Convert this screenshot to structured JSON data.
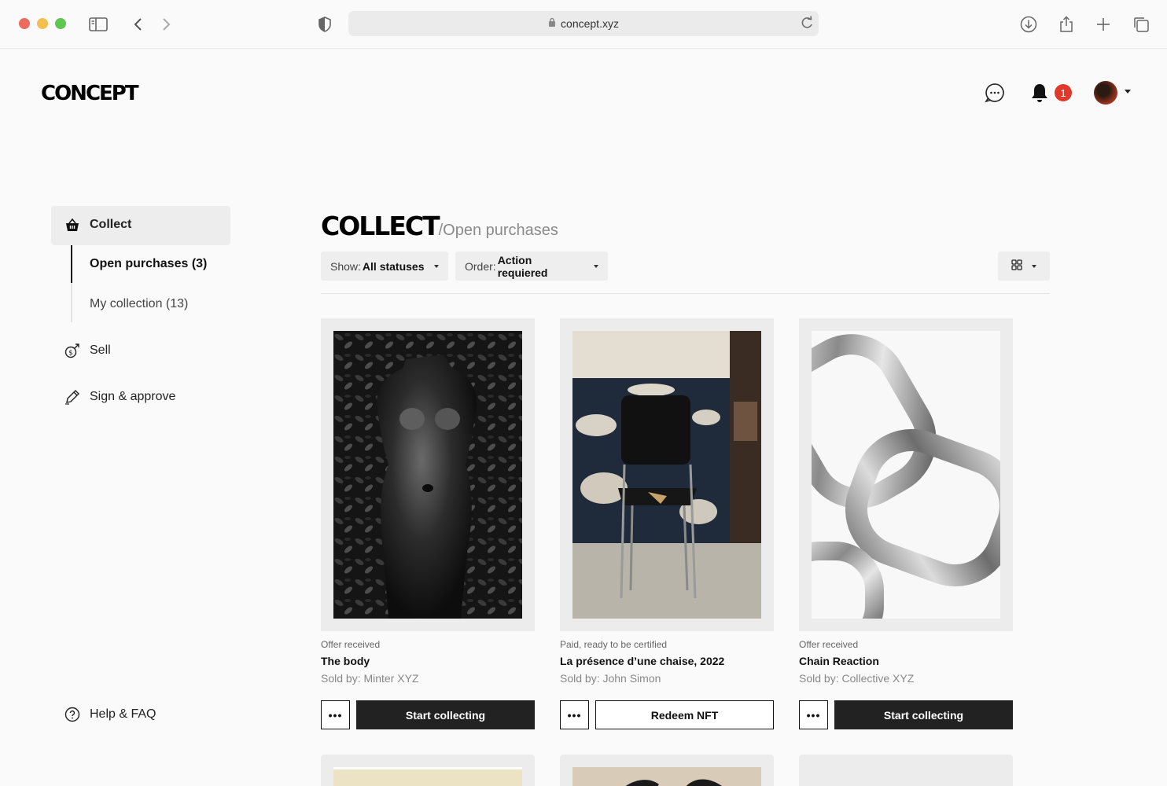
{
  "browser": {
    "url": "concept.xyz"
  },
  "header": {
    "logo": "CONCEPT",
    "notification_count": "1",
    "icons": [
      "chat-icon",
      "bell-icon",
      "avatar"
    ]
  },
  "sidebar": {
    "collect": "Collect",
    "sub_items": [
      {
        "label": "Open purchases (3)"
      },
      {
        "label": "My collection (13)"
      }
    ],
    "sell": "Sell",
    "sign": "Sign & approve",
    "help": "Help & FAQ"
  },
  "main": {
    "title": "COLLECT",
    "breadcrumb": "/Open purchases",
    "filters": {
      "show_label": "Show:",
      "show_value": "All statuses",
      "order_label": "Order:",
      "order_value": "Action requiered"
    },
    "cards": [
      {
        "status": "Offer received",
        "title": "The body",
        "seller": "Sold by: Minter XYZ",
        "cta": "Start collecting",
        "more": "•••"
      },
      {
        "status": "Paid, ready to be certified",
        "title": "La présence d’une chaise, 2022",
        "seller": "Sold by: John Simon",
        "cta": "Redeem NFT",
        "more": "•••"
      },
      {
        "status": "Offer received",
        "title": "Chain Reaction",
        "seller": "Sold by: Collective XYZ",
        "cta": "Start collecting",
        "more": "•••"
      }
    ]
  },
  "colors": {
    "accent": "#222222",
    "badge": "#e0392b",
    "background": "#fafafa"
  }
}
